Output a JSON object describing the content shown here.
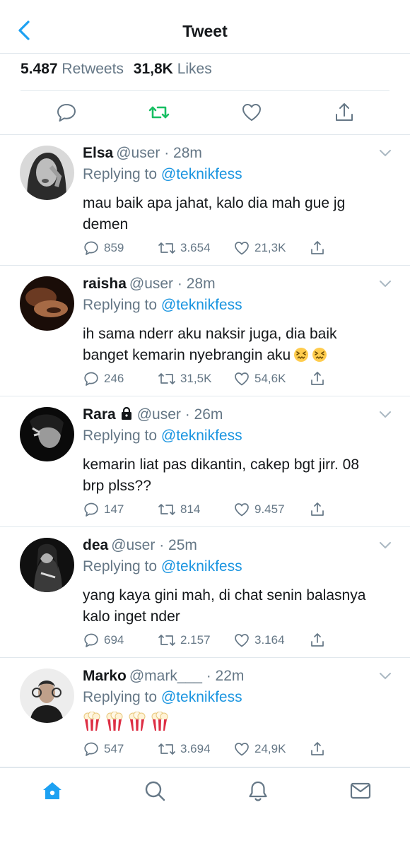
{
  "header": {
    "title": "Tweet"
  },
  "stats": {
    "retweets_count": "5.487",
    "retweets_label": "Retweets",
    "likes_count": "31,8K",
    "likes_label": "Likes"
  },
  "colors": {
    "accent": "#1da1f2",
    "mention": "#1b95e0",
    "retweet_active": "#17bf63",
    "muted": "#657786"
  },
  "replies": [
    {
      "name": "Elsa",
      "locked": false,
      "handle": "@user",
      "time": "· 28m",
      "replying_prefix": "Replying to",
      "replying_to": "@teknikfess",
      "text": "mau baik apa jahat, kalo dia mah gue jg demen",
      "emoji_count": 0,
      "reply_count": "859",
      "retweet_count": "3.654",
      "like_count": "21,3K"
    },
    {
      "name": "raisha",
      "locked": false,
      "handle": "@user",
      "time": "· 28m",
      "replying_prefix": "Replying to",
      "replying_to": "@teknikfess",
      "text": "ih sama nderr aku naksir juga, dia baik banget kemarin nyebrangin aku",
      "emoji_count": 2,
      "emoji": "confounded-face",
      "reply_count": "246",
      "retweet_count": "31,5K",
      "like_count": "54,6K"
    },
    {
      "name": "Rara",
      "locked": true,
      "handle": "@user",
      "time": "· 26m",
      "replying_prefix": "Replying to",
      "replying_to": "@teknikfess",
      "text": "kemarin liat pas dikantin, cakep bgt jirr. 08 brp plss??",
      "emoji_count": 0,
      "reply_count": "147",
      "retweet_count": "814",
      "like_count": "9.457"
    },
    {
      "name": "dea",
      "locked": false,
      "handle": "@user",
      "time": "· 25m",
      "replying_prefix": "Replying to",
      "replying_to": "@teknikfess",
      "text": "yang kaya gini mah, di chat senin balasnya kalo inget nder",
      "emoji_count": 0,
      "reply_count": "694",
      "retweet_count": "2.157",
      "like_count": "3.164"
    },
    {
      "name": "Marko",
      "locked": false,
      "handle": "@mark___",
      "time": "· 22m",
      "replying_prefix": "Replying to",
      "replying_to": "@teknikfess",
      "text": "",
      "emoji_count": 4,
      "emoji": "popcorn",
      "reply_count": "547",
      "retweet_count": "3.694",
      "like_count": "24,9K"
    }
  ],
  "tabbar": {
    "items": [
      {
        "icon": "home-icon",
        "active": true
      },
      {
        "icon": "search-icon",
        "active": false
      },
      {
        "icon": "notifications-icon",
        "active": false
      },
      {
        "icon": "messages-icon",
        "active": false
      }
    ]
  }
}
